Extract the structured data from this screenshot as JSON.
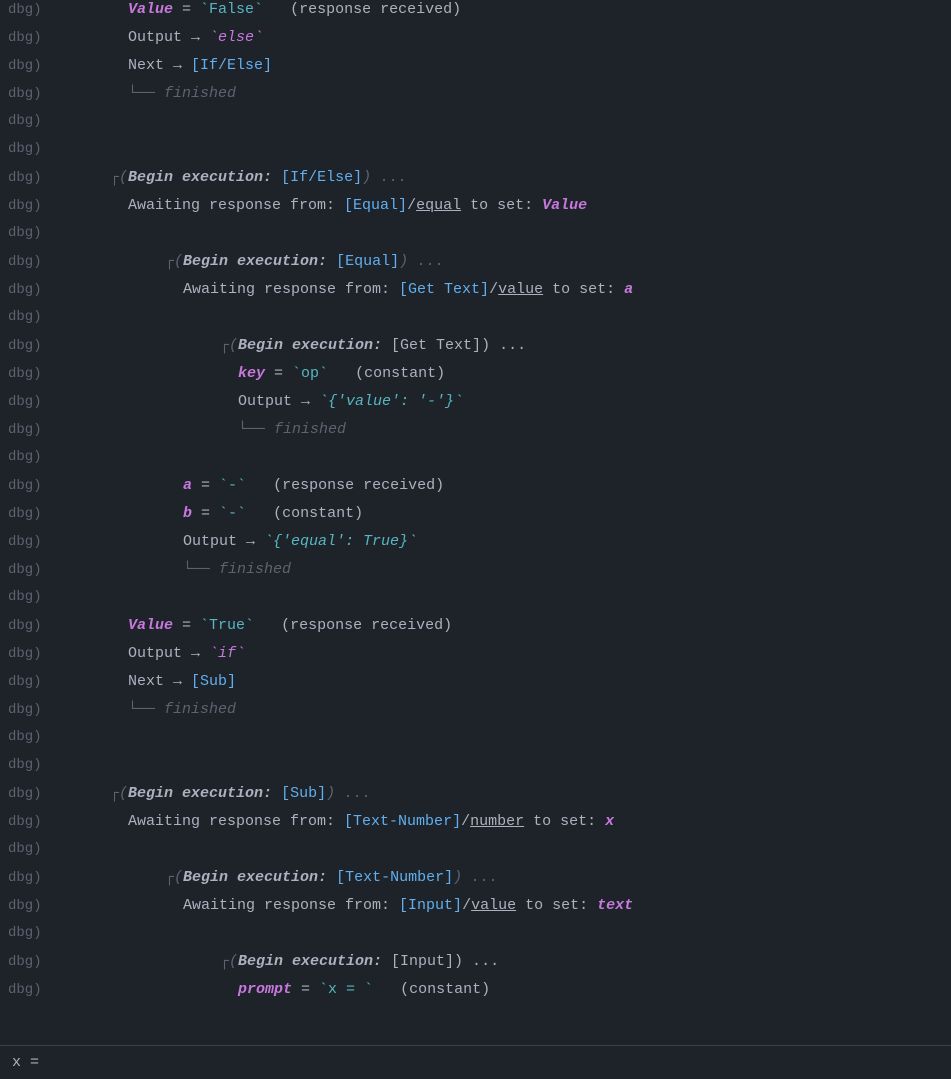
{
  "lines": [
    {
      "prefix": "dbg)",
      "indent": 0,
      "content": [
        {
          "t": "  ",
          "c": "white"
        },
        {
          "t": "Value",
          "c": "purple italic bold"
        },
        {
          "t": " = ",
          "c": "white"
        },
        {
          "t": "`False`",
          "c": "cyan"
        },
        {
          "t": "   (response received)",
          "c": "white"
        }
      ]
    },
    {
      "prefix": "dbg)",
      "indent": 0,
      "content": [
        {
          "t": "  Output → ",
          "c": "white"
        },
        {
          "t": "`else`",
          "c": "purple italic"
        }
      ]
    },
    {
      "prefix": "dbg)",
      "indent": 0,
      "content": [
        {
          "t": "  Next → ",
          "c": "white"
        },
        {
          "t": "[If/Else]",
          "c": "blue"
        }
      ]
    },
    {
      "prefix": "dbg)",
      "indent": 0,
      "content": [
        {
          "t": "  └── ",
          "c": "gray"
        },
        {
          "t": "finished",
          "c": "gray"
        }
      ]
    },
    {
      "prefix": "dbg)",
      "indent": 0,
      "content": []
    },
    {
      "prefix": "dbg)",
      "indent": 0,
      "content": []
    },
    {
      "prefix": "dbg)",
      "indent": 0,
      "content": [
        {
          "t": "┌(",
          "c": "gray"
        },
        {
          "t": "Begin execution:",
          "c": "white italic bold"
        },
        {
          "t": " ",
          "c": "white"
        },
        {
          "t": "[If/Else]",
          "c": "blue"
        },
        {
          "t": ") ...",
          "c": "gray"
        }
      ]
    },
    {
      "prefix": "dbg)",
      "indent": 0,
      "content": [
        {
          "t": "  Awaiting response from: ",
          "c": "white"
        },
        {
          "t": "[Equal]",
          "c": "blue"
        },
        {
          "t": "/",
          "c": "white"
        },
        {
          "t": "equal",
          "c": "white underline"
        },
        {
          "t": " to set: ",
          "c": "white"
        },
        {
          "t": "Value",
          "c": "purple italic bold"
        }
      ]
    },
    {
      "prefix": "dbg)",
      "indent": 0,
      "content": []
    },
    {
      "prefix": "dbg)",
      "indent": 1,
      "content": [
        {
          "t": "┌(",
          "c": "gray"
        },
        {
          "t": "Begin execution:",
          "c": "white italic bold"
        },
        {
          "t": " ",
          "c": "white"
        },
        {
          "t": "[Equal]",
          "c": "blue"
        },
        {
          "t": ") ...",
          "c": "gray"
        }
      ]
    },
    {
      "prefix": "dbg)",
      "indent": 1,
      "content": [
        {
          "t": "  Awaiting response from: ",
          "c": "white"
        },
        {
          "t": "[Get Text]",
          "c": "blue"
        },
        {
          "t": "/",
          "c": "white"
        },
        {
          "t": "value",
          "c": "white underline"
        },
        {
          "t": " to set: ",
          "c": "white"
        },
        {
          "t": "a",
          "c": "purple italic bold"
        }
      ]
    },
    {
      "prefix": "dbg)",
      "indent": 1,
      "content": []
    },
    {
      "prefix": "dbg)",
      "indent": 2,
      "content": [
        {
          "t": "┌(",
          "c": "gray"
        },
        {
          "t": "Begin execution:",
          "c": "white italic bold"
        },
        {
          "t": " [Get Text]) ...",
          "c": "white"
        }
      ]
    },
    {
      "prefix": "dbg)",
      "indent": 2,
      "content": [
        {
          "t": "  ",
          "c": "white"
        },
        {
          "t": "key",
          "c": "purple italic bold"
        },
        {
          "t": " = ",
          "c": "white"
        },
        {
          "t": "`op`",
          "c": "cyan"
        },
        {
          "t": "   (constant)",
          "c": "white"
        }
      ]
    },
    {
      "prefix": "dbg)",
      "indent": 2,
      "content": [
        {
          "t": "  Output → ",
          "c": "white"
        },
        {
          "t": "`{'value': '-'}`",
          "c": "cyan italic"
        }
      ]
    },
    {
      "prefix": "dbg)",
      "indent": 2,
      "content": [
        {
          "t": "  └── ",
          "c": "gray"
        },
        {
          "t": "finished",
          "c": "gray"
        }
      ]
    },
    {
      "prefix": "dbg)",
      "indent": 1,
      "content": []
    },
    {
      "prefix": "dbg)",
      "indent": 1,
      "content": [
        {
          "t": "  ",
          "c": "white"
        },
        {
          "t": "a",
          "c": "purple italic bold"
        },
        {
          "t": " = ",
          "c": "white"
        },
        {
          "t": "`-`",
          "c": "cyan"
        },
        {
          "t": "   (response received)",
          "c": "white"
        }
      ]
    },
    {
      "prefix": "dbg)",
      "indent": 1,
      "content": [
        {
          "t": "  ",
          "c": "white"
        },
        {
          "t": "b",
          "c": "purple italic bold"
        },
        {
          "t": " = ",
          "c": "white"
        },
        {
          "t": "`-`",
          "c": "cyan"
        },
        {
          "t": "   (constant)",
          "c": "white"
        }
      ]
    },
    {
      "prefix": "dbg)",
      "indent": 1,
      "content": [
        {
          "t": "  Output → ",
          "c": "white"
        },
        {
          "t": "`{'equal': True}`",
          "c": "cyan italic"
        }
      ]
    },
    {
      "prefix": "dbg)",
      "indent": 1,
      "content": [
        {
          "t": "  └── ",
          "c": "gray"
        },
        {
          "t": "finished",
          "c": "gray"
        }
      ]
    },
    {
      "prefix": "dbg)",
      "indent": 0,
      "content": []
    },
    {
      "prefix": "dbg)",
      "indent": 0,
      "content": [
        {
          "t": "  ",
          "c": "white"
        },
        {
          "t": "Value",
          "c": "purple italic bold"
        },
        {
          "t": " = ",
          "c": "white"
        },
        {
          "t": "`True`",
          "c": "cyan"
        },
        {
          "t": "   (response received)",
          "c": "white"
        }
      ]
    },
    {
      "prefix": "dbg)",
      "indent": 0,
      "content": [
        {
          "t": "  Output → ",
          "c": "white"
        },
        {
          "t": "`if`",
          "c": "purple italic"
        }
      ]
    },
    {
      "prefix": "dbg)",
      "indent": 0,
      "content": [
        {
          "t": "  Next → ",
          "c": "white"
        },
        {
          "t": "[Sub]",
          "c": "blue"
        }
      ]
    },
    {
      "prefix": "dbg)",
      "indent": 0,
      "content": [
        {
          "t": "  └── ",
          "c": "gray"
        },
        {
          "t": "finished",
          "c": "gray"
        }
      ]
    },
    {
      "prefix": "dbg)",
      "indent": 0,
      "content": []
    },
    {
      "prefix": "dbg)",
      "indent": 0,
      "content": []
    },
    {
      "prefix": "dbg)",
      "indent": 0,
      "content": [
        {
          "t": "┌(",
          "c": "gray"
        },
        {
          "t": "Begin execution:",
          "c": "white italic bold"
        },
        {
          "t": " ",
          "c": "white"
        },
        {
          "t": "[Sub]",
          "c": "blue"
        },
        {
          "t": ") ...",
          "c": "gray"
        }
      ]
    },
    {
      "prefix": "dbg)",
      "indent": 0,
      "content": [
        {
          "t": "  Awaiting response from: ",
          "c": "white"
        },
        {
          "t": "[Text-Number]",
          "c": "blue"
        },
        {
          "t": "/",
          "c": "white"
        },
        {
          "t": "number",
          "c": "white underline"
        },
        {
          "t": " to set: ",
          "c": "white"
        },
        {
          "t": "x",
          "c": "purple italic bold"
        }
      ]
    },
    {
      "prefix": "dbg)",
      "indent": 0,
      "content": []
    },
    {
      "prefix": "dbg)",
      "indent": 1,
      "content": [
        {
          "t": "┌(",
          "c": "gray"
        },
        {
          "t": "Begin execution:",
          "c": "white italic bold"
        },
        {
          "t": " ",
          "c": "white"
        },
        {
          "t": "[Text-Number]",
          "c": "blue"
        },
        {
          "t": ") ...",
          "c": "gray"
        }
      ]
    },
    {
      "prefix": "dbg)",
      "indent": 1,
      "content": [
        {
          "t": "  Awaiting response from: ",
          "c": "white"
        },
        {
          "t": "[Input]",
          "c": "blue"
        },
        {
          "t": "/",
          "c": "white"
        },
        {
          "t": "value",
          "c": "white underline"
        },
        {
          "t": " to set: ",
          "c": "white"
        },
        {
          "t": "text",
          "c": "purple italic bold"
        }
      ]
    },
    {
      "prefix": "dbg)",
      "indent": 1,
      "content": []
    },
    {
      "prefix": "dbg)",
      "indent": 2,
      "content": [
        {
          "t": "┌(",
          "c": "gray"
        },
        {
          "t": "Begin execution:",
          "c": "white italic bold"
        },
        {
          "t": " [Input]) ...",
          "c": "white"
        }
      ]
    },
    {
      "prefix": "dbg)",
      "indent": 2,
      "content": [
        {
          "t": "  ",
          "c": "white"
        },
        {
          "t": "prompt",
          "c": "purple italic bold"
        },
        {
          "t": " = ",
          "c": "white"
        },
        {
          "t": "`x = `",
          "c": "cyan"
        },
        {
          "t": "   (constant)",
          "c": "white"
        }
      ]
    }
  ],
  "bottom_bar": "x ="
}
